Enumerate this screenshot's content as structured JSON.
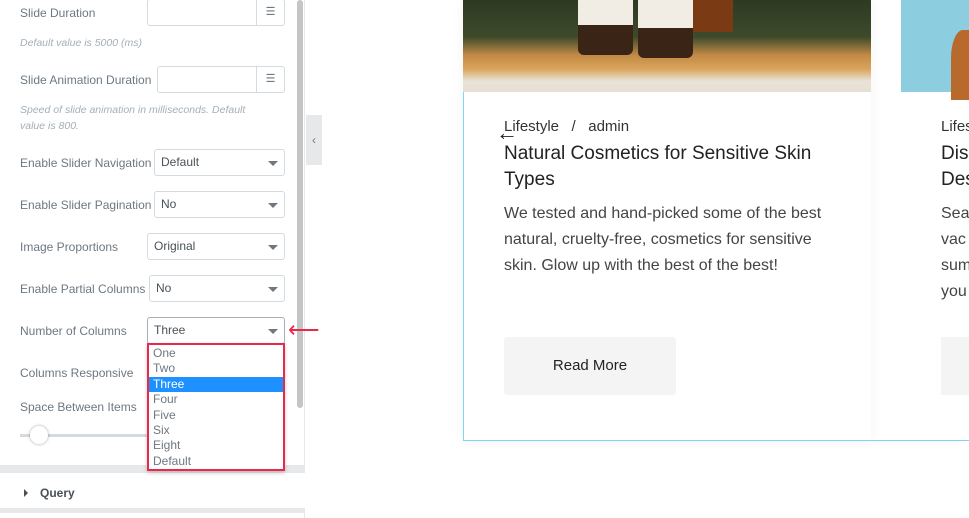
{
  "panel": {
    "slide_duration": {
      "label": "Slide Duration",
      "value": "",
      "help": "Default value is 5000 (ms)"
    },
    "slide_animation_duration": {
      "label": "Slide Animation Duration",
      "value": "",
      "help": "Speed of slide animation in milliseconds. Default value is 800."
    },
    "slider_navigation": {
      "label": "Enable Slider Navigation",
      "value": "Default"
    },
    "slider_pagination": {
      "label": "Enable Slider Pagination",
      "value": "No"
    },
    "image_proportions": {
      "label": "Image Proportions",
      "value": "Original"
    },
    "partial_columns": {
      "label": "Enable Partial Columns",
      "value": "No"
    },
    "number_of_columns": {
      "label": "Number of Columns",
      "value": "Three",
      "options": [
        "One",
        "Two",
        "Three",
        "Four",
        "Five",
        "Six",
        "Eight",
        "Default"
      ]
    },
    "columns_responsive": {
      "label": "Columns Responsive"
    },
    "space_between": {
      "label": "Space Between Items",
      "slider_fraction": 0.1
    },
    "query_section": "Query",
    "collapse_icon": "‹"
  },
  "cards": [
    {
      "category": "Lifestyle",
      "separator": "/",
      "author": "admin",
      "title": "Natural Cosmetics for Sensitive Skin Types",
      "excerpt": "We tested and hand-picked some of the best natural, cruelty-free, cosmetics for sensitive skin. Glow up with the best of the best!",
      "button": "Read More"
    },
    {
      "category": "Lifes",
      "title_lines": [
        "Dis",
        "Des"
      ],
      "excerpt_lines": [
        "Sea",
        "vac",
        "sum",
        "you"
      ]
    }
  ],
  "colors": {
    "highlight": "#1e90ff",
    "annotation": "#e8294c",
    "card_outline": "#7fd6f2"
  }
}
